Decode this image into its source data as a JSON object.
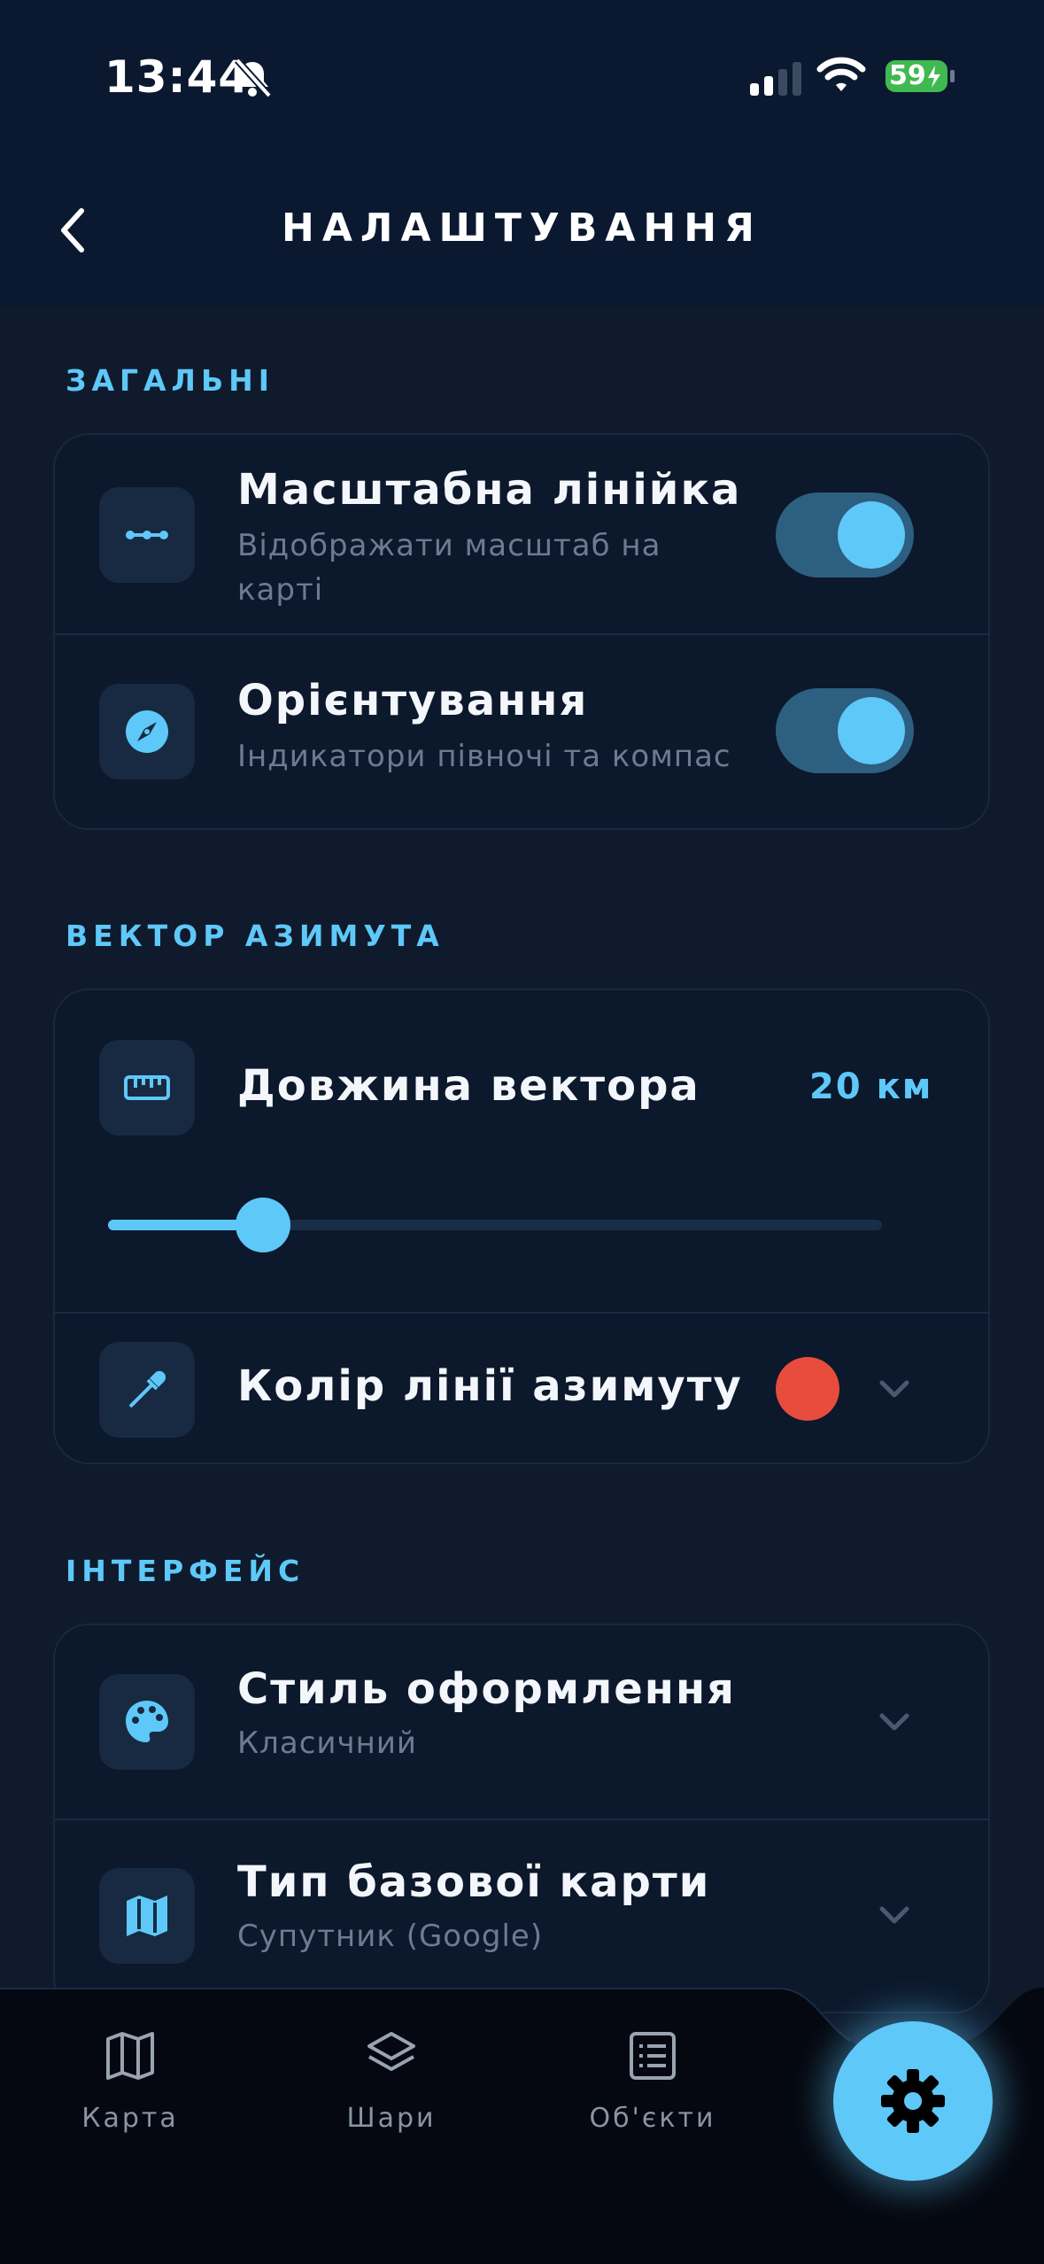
{
  "status_bar": {
    "time": "13:44",
    "battery": "59"
  },
  "header": {
    "title": "НАЛАШТУВАННЯ"
  },
  "sections": {
    "general": {
      "label": "ЗАГАЛЬНІ",
      "scale_ruler": {
        "title": "Масштабна лінійка",
        "subtitle": "Відображати масштаб на карті",
        "enabled": true
      },
      "orientation": {
        "title": "Орієнтування",
        "subtitle": "Індикатори півночі та компас",
        "enabled": true
      }
    },
    "azimuth": {
      "label": "ВЕКТОР АЗИМУТА",
      "length": {
        "title": "Довжина вектора",
        "value": "20 км",
        "slider_fraction": 0.2
      },
      "line_color": {
        "title": "Колір лінії азимуту",
        "color": "#e74c3c"
      }
    },
    "interface": {
      "label": "ІНТЕРФЕЙС",
      "style": {
        "title": "Стиль оформлення",
        "subtitle": "Класичний"
      },
      "basemap": {
        "title": "Тип базової карти",
        "subtitle": "Супутник (Google)"
      }
    }
  },
  "tabbar": {
    "tabs": [
      {
        "label": "Карта",
        "icon": "map-icon"
      },
      {
        "label": "Шари",
        "icon": "layers-icon"
      },
      {
        "label": "Об'єкти",
        "icon": "list-icon"
      }
    ],
    "active": {
      "icon": "gear-icon"
    }
  },
  "colors": {
    "accent": "#5ec8f8",
    "background": "#0f1a2c",
    "card": "#0c182b",
    "header": "#0b1930",
    "danger_dot": "#e74c3c"
  }
}
